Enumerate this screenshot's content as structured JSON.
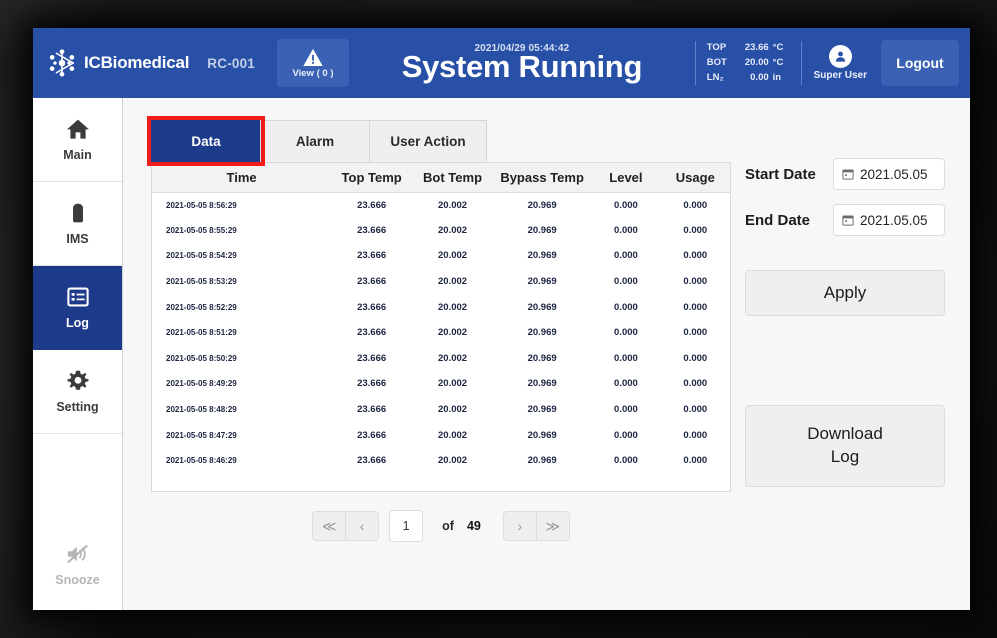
{
  "header": {
    "brand_name": "ICBiomedical",
    "unit_id": "RC-001",
    "alarm_view_label": "View ( 0 )",
    "datetime": "2021/04/29 05:44:42",
    "system_status": "System Running",
    "readouts": [
      {
        "label": "TOP",
        "value": "23.66",
        "unit": "°C"
      },
      {
        "label": "BOT",
        "value": "20.00",
        "unit": "°C"
      },
      {
        "label": "LN₂",
        "value": "0.00",
        "unit": "in"
      }
    ],
    "user_name": "Super User",
    "logout_label": "Logout"
  },
  "sidebar": {
    "items": [
      {
        "label": "Main",
        "icon": "home-icon",
        "selected": false,
        "disabled": false
      },
      {
        "label": "IMS",
        "icon": "tank-icon",
        "selected": false,
        "disabled": false
      },
      {
        "label": "Log",
        "icon": "list-icon",
        "selected": true,
        "disabled": false
      },
      {
        "label": "Setting",
        "icon": "gear-icon",
        "selected": false,
        "disabled": false
      },
      {
        "label": "Snooze",
        "icon": "mute-icon",
        "selected": false,
        "disabled": true
      }
    ]
  },
  "tabs": [
    {
      "label": "Data",
      "active": true,
      "highlighted": true
    },
    {
      "label": "Alarm",
      "active": false,
      "highlighted": false
    },
    {
      "label": "User Action",
      "active": false,
      "highlighted": false
    }
  ],
  "table": {
    "columns": [
      "Time",
      "Top Temp",
      "Bot Temp",
      "Bypass Temp",
      "Level",
      "Usage"
    ],
    "rows": [
      [
        "2021-05-05 8:56:29",
        "23.666",
        "20.002",
        "20.969",
        "0.000",
        "0.000"
      ],
      [
        "2021-05-05 8:55:29",
        "23.666",
        "20.002",
        "20.969",
        "0.000",
        "0.000"
      ],
      [
        "2021-05-05 8:54:29",
        "23.666",
        "20.002",
        "20.969",
        "0.000",
        "0.000"
      ],
      [
        "2021-05-05 8:53:29",
        "23.666",
        "20.002",
        "20.969",
        "0.000",
        "0.000"
      ],
      [
        "2021-05-05 8:52:29",
        "23.666",
        "20.002",
        "20.969",
        "0.000",
        "0.000"
      ],
      [
        "2021-05-05 8:51:29",
        "23.666",
        "20.002",
        "20.969",
        "0.000",
        "0.000"
      ],
      [
        "2021-05-05 8:50:29",
        "23.666",
        "20.002",
        "20.969",
        "0.000",
        "0.000"
      ],
      [
        "2021-05-05 8:49:29",
        "23.666",
        "20.002",
        "20.969",
        "0.000",
        "0.000"
      ],
      [
        "2021-05-05 8:48:29",
        "23.666",
        "20.002",
        "20.969",
        "0.000",
        "0.000"
      ],
      [
        "2021-05-05 8:47:29",
        "23.666",
        "20.002",
        "20.969",
        "0.000",
        "0.000"
      ],
      [
        "2021-05-05 8:46:29",
        "23.666",
        "20.002",
        "20.969",
        "0.000",
        "0.000"
      ]
    ]
  },
  "pagination": {
    "first_label": "≪",
    "prev_label": "‹",
    "current_page": "1",
    "of_label": "of",
    "total_pages": "49",
    "next_label": "›",
    "last_label": "≫"
  },
  "filters": {
    "start_date_label": "Start Date",
    "start_date_value": "2021.05.05",
    "end_date_label": "End Date",
    "end_date_value": "2021.05.05",
    "apply_label": "Apply",
    "download_label_line1": "Download",
    "download_label_line2": "Log"
  },
  "colors": {
    "header_blue": "#2850a7",
    "accent_navy": "#1e3a8a",
    "header_button": "#3a61b4",
    "highlight_red": "#f21b1b",
    "panel_gray": "#f7f7f7"
  }
}
